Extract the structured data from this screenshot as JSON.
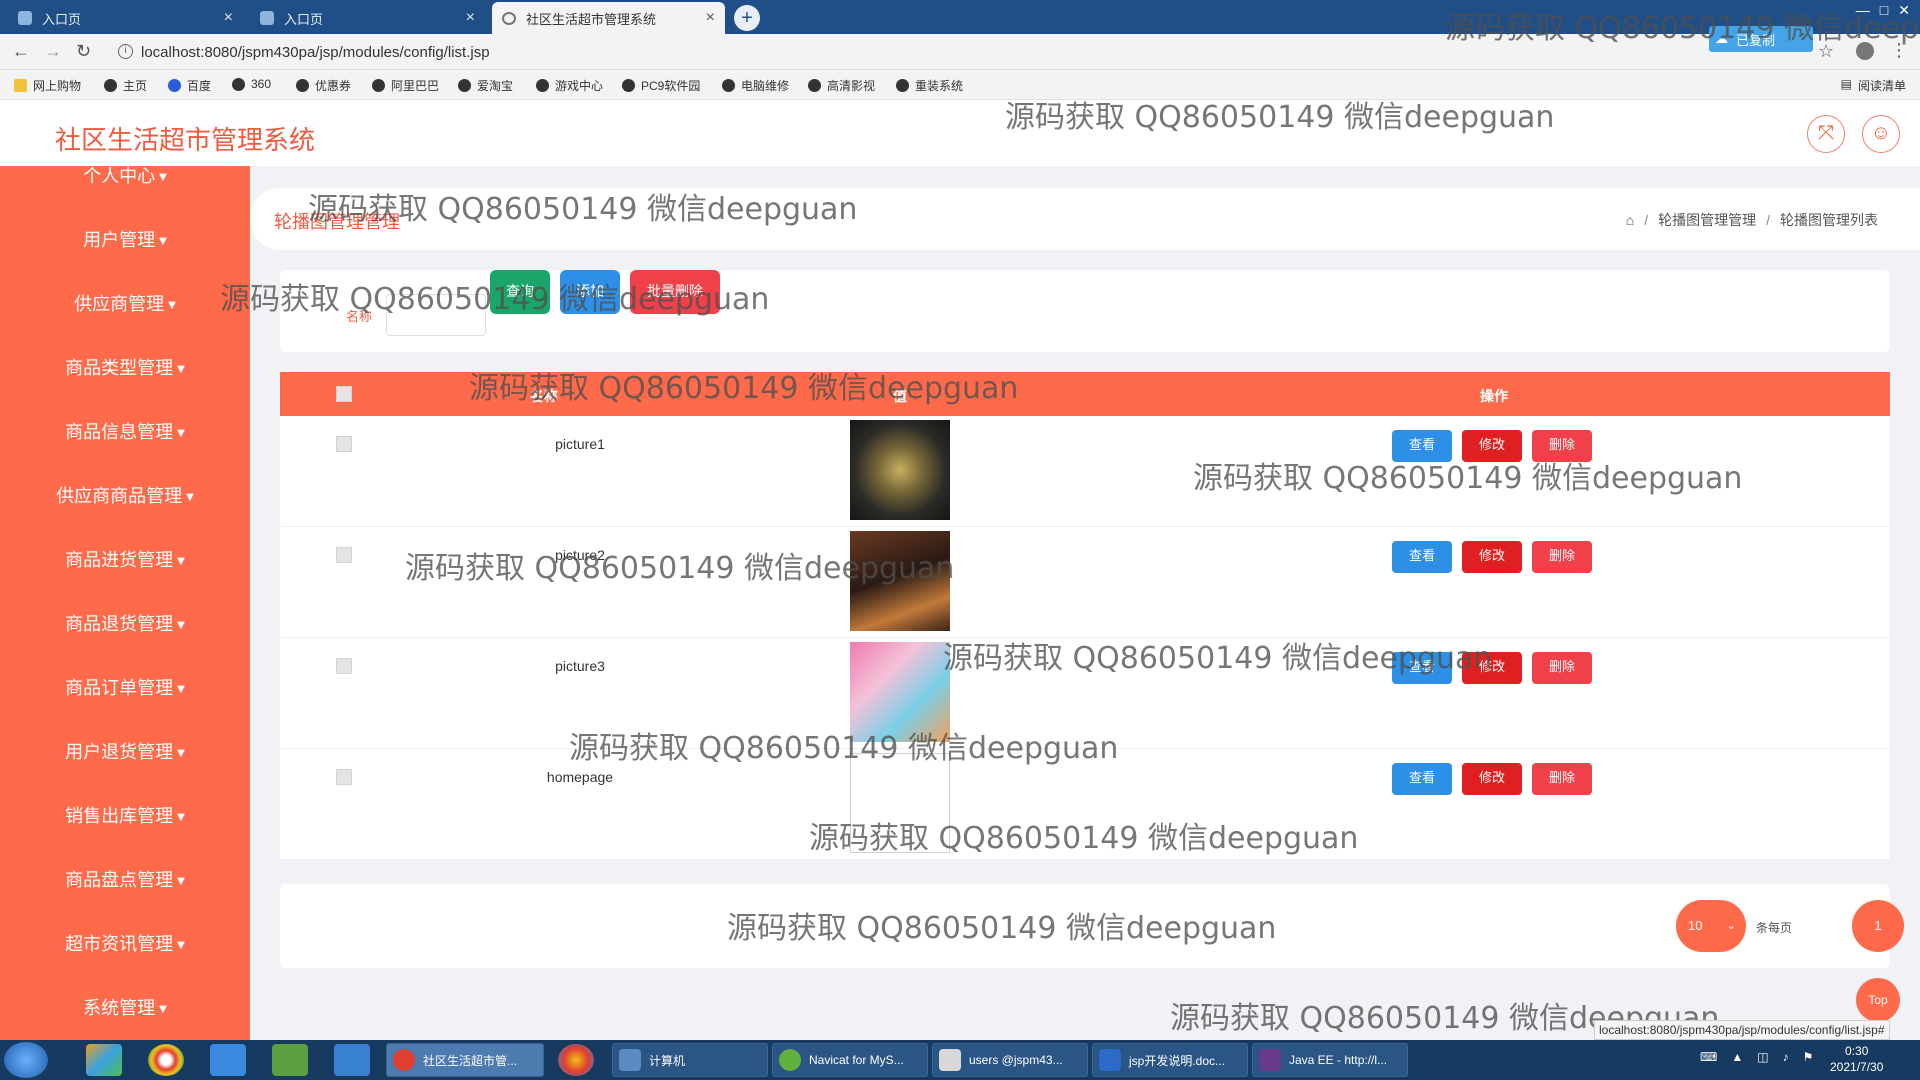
{
  "browser": {
    "tabs": [
      {
        "label": "入口页",
        "active": false
      },
      {
        "label": "入口页",
        "active": false
      },
      {
        "label": "社区生活超市管理系统",
        "active": true
      }
    ],
    "new_tab_label": "+",
    "url": "localhost:8080/jspm430pa/jsp/modules/config/list.jsp",
    "bookmarks": [
      "网上购物",
      "主页",
      "百度",
      "360",
      "优惠券",
      "阿里巴巴",
      "爱淘宝",
      "游戏中心",
      "PC9软件园",
      "电脑维修",
      "高清影视",
      "重装系统"
    ],
    "reading_list": "阅读清单",
    "extension_label": "已复制"
  },
  "app": {
    "title": "社区生活超市管理系统",
    "header_icons": [
      "fullscreen-icon",
      "user-icon"
    ]
  },
  "sidebar": {
    "items": [
      {
        "label": "个人中心"
      },
      {
        "label": "用户管理"
      },
      {
        "label": "供应商管理"
      },
      {
        "label": "商品类型管理"
      },
      {
        "label": "商品信息管理"
      },
      {
        "label": "供应商商品管理"
      },
      {
        "label": "商品进货管理"
      },
      {
        "label": "商品退货管理"
      },
      {
        "label": "商品订单管理"
      },
      {
        "label": "用户退货管理"
      },
      {
        "label": "销售出库管理"
      },
      {
        "label": "商品盘点管理"
      },
      {
        "label": "超市资讯管理"
      },
      {
        "label": "系统管理"
      }
    ]
  },
  "page": {
    "heading": "轮播图管理管理",
    "breadcrumb": [
      "轮播图管理管理",
      "轮播图管理列表"
    ]
  },
  "search": {
    "label": "名称",
    "value": "",
    "query_button": "查询",
    "add_button": "添加",
    "batch_delete_button": "批量删除"
  },
  "table": {
    "columns": [
      "名称",
      "值",
      "操作"
    ],
    "rows": [
      {
        "name": "picture1",
        "image": "photo"
      },
      {
        "name": "picture2",
        "image": "photo"
      },
      {
        "name": "picture3",
        "image": "photo"
      },
      {
        "name": "homepage",
        "image": "broken"
      }
    ],
    "actions": {
      "view": "查看",
      "edit": "修改",
      "delete": "删除"
    }
  },
  "pagination": {
    "page_size": "10",
    "per_page_label": "条每页",
    "current_page": "1"
  },
  "top_button": "Top",
  "status_url": "localhost:8080/jspm430pa/jsp/modules/config/list.jsp#",
  "watermark": "源码获取 QQ86050149 微信deepguan",
  "taskbar": {
    "tasks": [
      "社区生活超市管...",
      "计算机",
      "Navicat for MyS...",
      "users @jspm43...",
      "jsp开发说明.doc...",
      "Java EE - http://l..."
    ],
    "time": "0:30",
    "date": "2021/7/30"
  },
  "colors": {
    "accent": "#fe6a4a",
    "title": "#f05a3f",
    "query": "#1aa56a",
    "add": "#2d8fe6",
    "batch_delete": "#f0404a",
    "view": "#2d8fe6",
    "edit": "#e02020",
    "delete": "#f0404a"
  }
}
